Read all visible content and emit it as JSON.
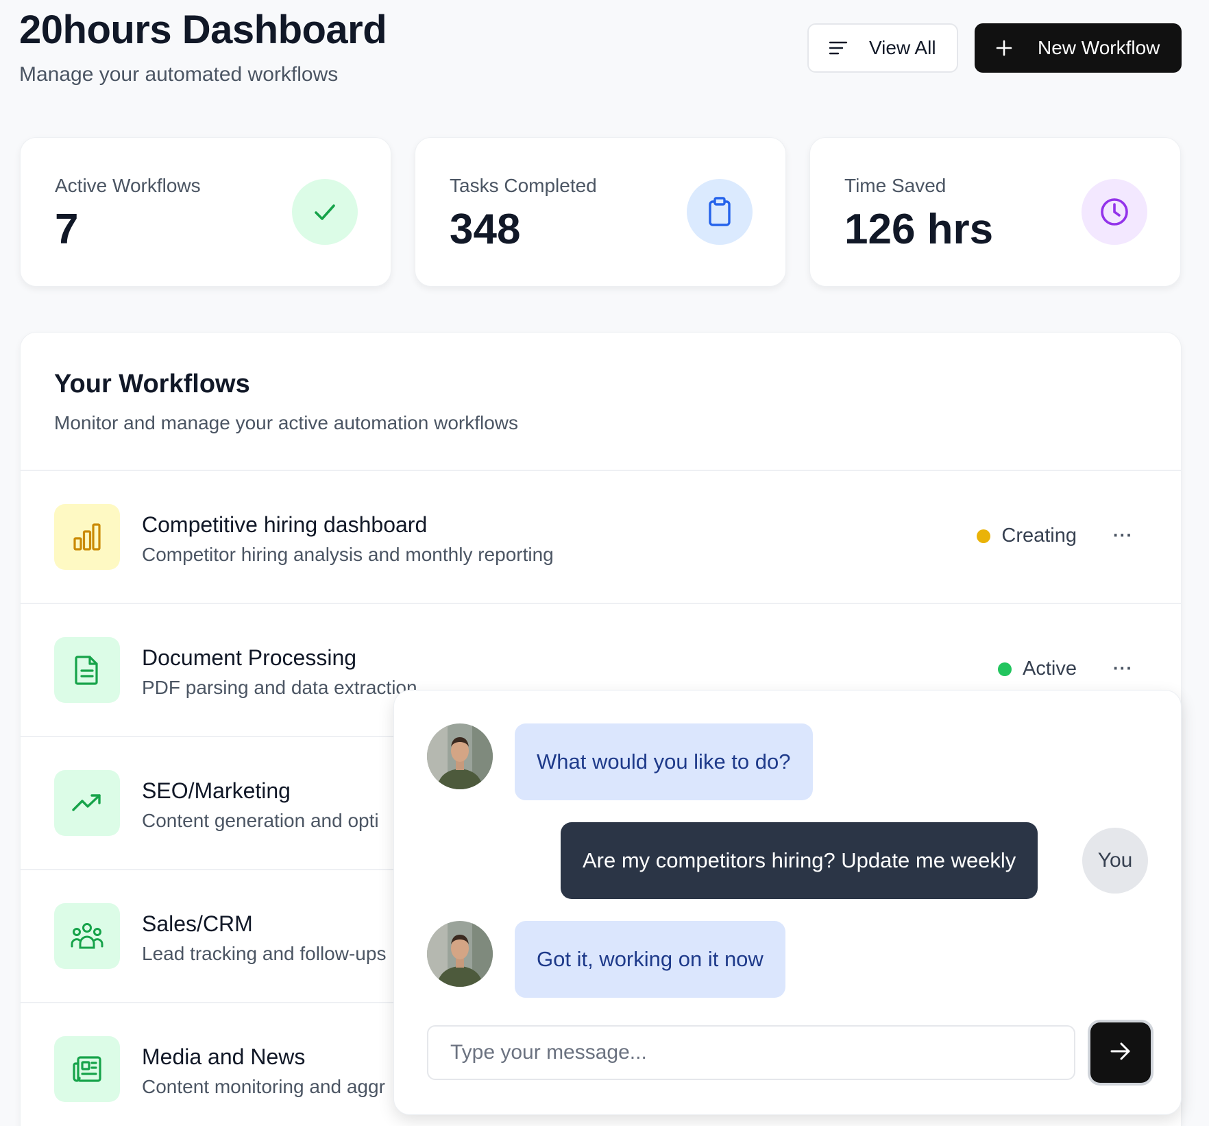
{
  "header": {
    "title": "20hours Dashboard",
    "subtitle": "Manage your automated workflows",
    "view_all_label": "View All",
    "new_workflow_label": "New Workflow"
  },
  "stats": [
    {
      "label": "Active Workflows",
      "value": "7",
      "icon": "check-icon",
      "icon_color": "#16a34a",
      "icon_bg": "#dcfce7"
    },
    {
      "label": "Tasks Completed",
      "value": "348",
      "icon": "clipboard-icon",
      "icon_color": "#2563eb",
      "icon_bg": "#dbeafe"
    },
    {
      "label": "Time Saved",
      "value": "126 hrs",
      "icon": "clock-icon",
      "icon_color": "#9333ea",
      "icon_bg": "#f3e8ff"
    }
  ],
  "workflows_panel": {
    "title": "Your Workflows",
    "subtitle": "Monitor and manage your active automation workflows",
    "items": [
      {
        "title": "Competitive hiring dashboard",
        "description": "Competitor hiring analysis and monthly reporting",
        "icon": "bar-chart-icon",
        "icon_color": "#ca8a04",
        "icon_bg": "#fef9c3",
        "status": "Creating",
        "status_color": "#eab308"
      },
      {
        "title": "Document Processing",
        "description": "PDF parsing and data extraction",
        "icon": "document-icon",
        "icon_color": "#16a34a",
        "icon_bg": "#dcfce7",
        "status": "Active",
        "status_color": "#22c55e"
      },
      {
        "title": "SEO/Marketing",
        "description": "Content generation and opti",
        "icon": "trending-up-icon",
        "icon_color": "#16a34a",
        "icon_bg": "#dcfce7"
      },
      {
        "title": "Sales/CRM",
        "description": "Lead tracking and follow-ups",
        "icon": "users-icon",
        "icon_color": "#16a34a",
        "icon_bg": "#dcfce7"
      },
      {
        "title": "Media and News",
        "description": "Content monitoring and aggr",
        "icon": "newspaper-icon",
        "icon_color": "#16a34a",
        "icon_bg": "#dcfce7"
      }
    ],
    "more_label": "···"
  },
  "chat": {
    "messages": [
      {
        "from": "assistant",
        "text": "What would you like to do?"
      },
      {
        "from": "user",
        "text": "Are my competitors hiring? Update me weekly"
      },
      {
        "from": "assistant",
        "text": "Got it, working on it now"
      }
    ],
    "user_badge": "You",
    "input_placeholder": "Type your message...",
    "send_icon": "arrow-right-icon"
  }
}
